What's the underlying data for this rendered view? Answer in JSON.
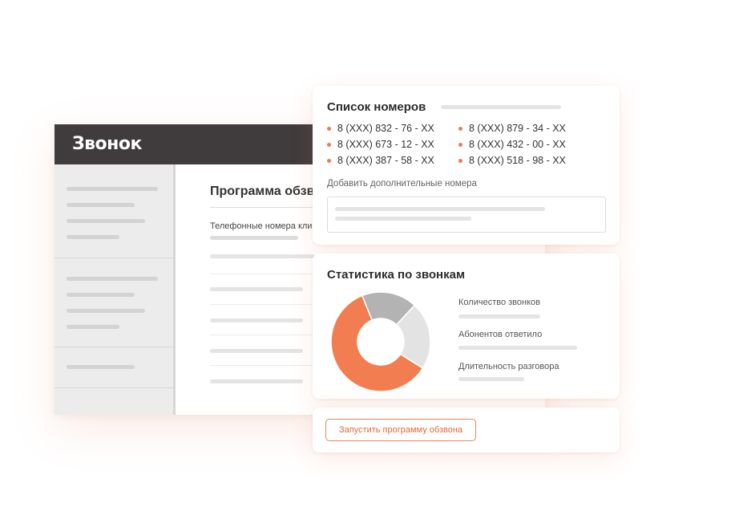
{
  "app": {
    "logo_text": "Звонок",
    "main_title": "Программа обзвона",
    "main_subtitle": "Телефонные номера клиентов"
  },
  "numbers_card": {
    "title": "Список номеров",
    "numbers": [
      "8 (XXX) 832 - 76 - XX",
      "8 (XXX) 673 - 12 - XX",
      "8 (XXX) 387 - 58 - XX",
      "8 (XXX) 879 - 34 - XX",
      "8 (XXX) 432 - 00 - XX",
      "8 (XXX) 518 - 98 - XX"
    ],
    "add_label": "Добавить дополнительные номера"
  },
  "stats_card": {
    "title": "Статистика по звонкам",
    "labels": [
      "Количество звонков",
      "Абонентов ответило",
      "Длительность разговора"
    ]
  },
  "chart_data": {
    "type": "pie",
    "title": "",
    "series": [
      {
        "values": [
          60,
          18,
          22
        ]
      }
    ],
    "colors": [
      "#f27d50",
      "#b3b3b3",
      "#e3e3e3"
    ],
    "donut": true
  },
  "actions": {
    "run_label": "Запустить программу обзвона"
  },
  "colors": {
    "accent": "#f07c4e",
    "header": "#403b3c",
    "sidebar": "#ececec"
  }
}
